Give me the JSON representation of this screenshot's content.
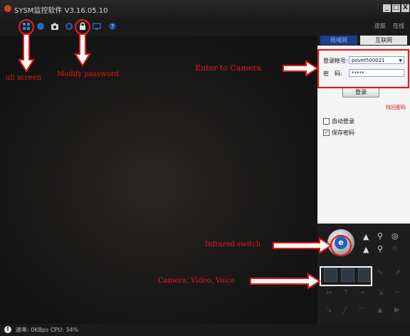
{
  "window": {
    "title": "SYSM监控软件 V3.16.05.10",
    "buttons": [
      "_",
      "□",
      "X"
    ]
  },
  "toolbar": {
    "icons": [
      "fullscreen-icon",
      "record-icon",
      "snapshot-icon",
      "settings-icon",
      "lock-icon",
      "monitor-icon",
      "help-icon"
    ]
  },
  "right_top": {
    "links": [
      "皮肤",
      "在线"
    ]
  },
  "tabs": {
    "local": "局域网",
    "internet": "互联网"
  },
  "login": {
    "account_label": "登录帐号:",
    "account_value": "povet500021",
    "password_label": "密　码:",
    "password_value": "*****",
    "login_button": "登录",
    "forgot": "找回密码",
    "auto_login": "自动登录",
    "save_password": "保存密码",
    "save_password_checked": "✓"
  },
  "ptz": {
    "center": "e"
  },
  "status": {
    "text": "速率: 0KBps  CPU: 34%"
  },
  "annotations": {
    "full_screen": "ull screen",
    "modify_password": "Modify password",
    "enter_camera": "Enter to Camera",
    "infrared": "Infrared switch",
    "media": "Camera, Video, Voice"
  },
  "colors": {
    "accent_red": "#e31b1b",
    "blue_tab": "#1b3f8a"
  }
}
